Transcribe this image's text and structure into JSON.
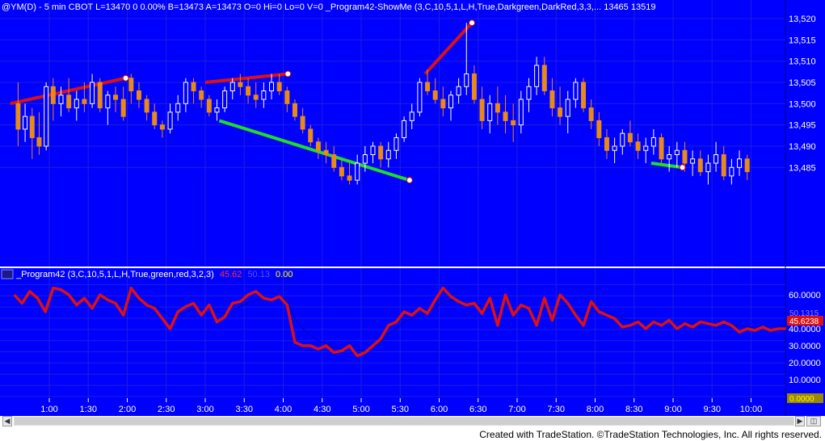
{
  "price_header": "@YM(D) - 5 min  CBOT  L=13470  0  0.00%  B=13473  A=13473  O=0  Hi=0  Lo=0  V=0  _Program42-ShowMe (3,C,10,5,1,L,H,True,Darkgreen,DarkRed,3,3,...  13465  13519",
  "indicator_header": {
    "name": "_Program42 (3,C,10,5,1,L,H,True,green,red,3,2,3)",
    "value1": "45.62",
    "value2": "50.13",
    "value3": "0.00",
    "value1_color": "#ff2020",
    "value2_color": "#4444ff",
    "value3_color": "#ffff00"
  },
  "price_axis_labels": [
    "13,520",
    "13,515",
    "13,510",
    "13,505",
    "13,500",
    "13,495",
    "13,490",
    "13,485"
  ],
  "indicator_axis_labels": [
    "60.0000",
    "40.0000",
    "30.0000",
    "20.0000",
    "10.0000"
  ],
  "indicator_value_tags": {
    "blue": "50.1315",
    "red": "45.6238",
    "yellow": "0.0000"
  },
  "time_axis_labels": [
    "1:00",
    "1:30",
    "2:00",
    "2:30",
    "3:00",
    "3:30",
    "4:00",
    "4:30",
    "5:00",
    "5:30",
    "6:00",
    "6:30",
    "7:00",
    "7:30",
    "8:00",
    "8:30",
    "9:00",
    "9:30",
    "10:00"
  ],
  "footer": "Created with TradeStation. ©TradeStation Technologies, Inc. All rights reserved.",
  "colors": {
    "background": "#0000ff",
    "grid": "#1e1ed8",
    "up_bar": "#ffffff",
    "down_bar": "#e88a18",
    "red_line": "#dd1111",
    "green_line": "#22dd22",
    "indicator_red": "#dd1111",
    "indicator_blue": "#0000aa"
  },
  "chart_data": {
    "type": "candlestick",
    "y_range": [
      13478,
      13522
    ],
    "x_range": [
      0.5,
      10.6
    ],
    "candles": [
      [
        0.6,
        13500,
        13505,
        13490,
        13494
      ],
      [
        0.69,
        13494,
        13500,
        13491,
        13497
      ],
      [
        0.78,
        13497,
        13499,
        13487,
        13492
      ],
      [
        0.87,
        13492,
        13498,
        13488,
        13490
      ],
      [
        0.96,
        13490,
        13505,
        13489,
        13504
      ],
      [
        1.05,
        13504,
        13506,
        13496,
        13500
      ],
      [
        1.15,
        13500,
        13504,
        13497,
        13502
      ],
      [
        1.25,
        13502,
        13506,
        13498,
        13499
      ],
      [
        1.35,
        13499,
        13503,
        13496,
        13501
      ],
      [
        1.45,
        13501,
        13505,
        13498,
        13500
      ],
      [
        1.55,
        13500,
        13507,
        13499,
        13505
      ],
      [
        1.65,
        13505,
        13506,
        13498,
        13499
      ],
      [
        1.75,
        13499,
        13503,
        13495,
        13502
      ],
      [
        1.85,
        13502,
        13504,
        13498,
        13501
      ],
      [
        1.95,
        13501,
        13504,
        13496,
        13497
      ],
      [
        2.05,
        13506,
        13507,
        13500,
        13503
      ],
      [
        2.15,
        13503,
        13505,
        13499,
        13501
      ],
      [
        2.25,
        13501,
        13502,
        13496,
        13498
      ],
      [
        2.35,
        13498,
        13500,
        13494,
        13495
      ],
      [
        2.45,
        13495,
        13496,
        13492,
        13494
      ],
      [
        2.55,
        13494,
        13500,
        13493,
        13498
      ],
      [
        2.65,
        13498,
        13502,
        13496,
        13500
      ],
      [
        2.75,
        13500,
        13506,
        13498,
        13505
      ],
      [
        2.85,
        13505,
        13506,
        13500,
        13503
      ],
      [
        2.95,
        13503,
        13504,
        13499,
        13501
      ],
      [
        3.05,
        13501,
        13502,
        13497,
        13498
      ],
      [
        3.15,
        13498,
        13501,
        13496,
        13499
      ],
      [
        3.25,
        13499,
        13504,
        13498,
        13503
      ],
      [
        3.35,
        13503,
        13506,
        13501,
        13505
      ],
      [
        3.45,
        13505,
        13507,
        13502,
        13504
      ],
      [
        3.55,
        13504,
        13506,
        13500,
        13502
      ],
      [
        3.65,
        13502,
        13505,
        13499,
        13501
      ],
      [
        3.75,
        13501,
        13505,
        13499,
        13503
      ],
      [
        3.85,
        13503,
        13507,
        13501,
        13505
      ],
      [
        3.95,
        13505,
        13507,
        13502,
        13503
      ],
      [
        4.05,
        13503,
        13504,
        13498,
        13500
      ],
      [
        4.15,
        13500,
        13501,
        13496,
        13497
      ],
      [
        4.25,
        13497,
        13499,
        13493,
        13494
      ],
      [
        4.35,
        13494,
        13495,
        13490,
        13491
      ],
      [
        4.45,
        13491,
        13492,
        13487,
        13489
      ],
      [
        4.55,
        13489,
        13491,
        13486,
        13488
      ],
      [
        4.65,
        13488,
        13490,
        13484,
        13485
      ],
      [
        4.75,
        13485,
        13487,
        13482,
        13483
      ],
      [
        4.85,
        13483,
        13486,
        13481,
        13482
      ],
      [
        4.95,
        13482,
        13488,
        13481,
        13486
      ],
      [
        5.05,
        13486,
        13490,
        13484,
        13488
      ],
      [
        5.15,
        13488,
        13491,
        13486,
        13490
      ],
      [
        5.25,
        13490,
        13491,
        13485,
        13487
      ],
      [
        5.35,
        13487,
        13491,
        13485,
        13489
      ],
      [
        5.45,
        13489,
        13493,
        13487,
        13492
      ],
      [
        5.55,
        13492,
        13497,
        13491,
        13496
      ],
      [
        5.65,
        13496,
        13500,
        13494,
        13498
      ],
      [
        5.75,
        13498,
        13506,
        13497,
        13505
      ],
      [
        5.85,
        13505,
        13508,
        13502,
        13503
      ],
      [
        5.95,
        13503,
        13506,
        13500,
        13501
      ],
      [
        6.05,
        13501,
        13504,
        13497,
        13499
      ],
      [
        6.15,
        13499,
        13503,
        13496,
        13502
      ],
      [
        6.25,
        13502,
        13506,
        13500,
        13504
      ],
      [
        6.35,
        13504,
        13519,
        13502,
        13507
      ],
      [
        6.45,
        13507,
        13509,
        13500,
        13501
      ],
      [
        6.55,
        13501,
        13504,
        13494,
        13496
      ],
      [
        6.65,
        13496,
        13502,
        13493,
        13500
      ],
      [
        6.75,
        13500,
        13504,
        13495,
        13498
      ],
      [
        6.85,
        13498,
        13502,
        13493,
        13496
      ],
      [
        6.95,
        13496,
        13500,
        13491,
        13495
      ],
      [
        7.05,
        13495,
        13503,
        13493,
        13501
      ],
      [
        7.15,
        13501,
        13506,
        13498,
        13504
      ],
      [
        7.25,
        13504,
        13511,
        13502,
        13509
      ],
      [
        7.35,
        13509,
        13511,
        13502,
        13503
      ],
      [
        7.45,
        13503,
        13506,
        13497,
        13499
      ],
      [
        7.55,
        13499,
        13504,
        13495,
        13497
      ],
      [
        7.65,
        13497,
        13503,
        13493,
        13501
      ],
      [
        7.75,
        13501,
        13506,
        13499,
        13505
      ],
      [
        7.85,
        13505,
        13506,
        13498,
        13499
      ],
      [
        7.95,
        13499,
        13501,
        13494,
        13496
      ],
      [
        8.05,
        13496,
        13498,
        13490,
        13492
      ],
      [
        8.15,
        13492,
        13494,
        13487,
        13489
      ],
      [
        8.25,
        13489,
        13492,
        13486,
        13490
      ],
      [
        8.35,
        13490,
        13494,
        13488,
        13493
      ],
      [
        8.45,
        13493,
        13496,
        13490,
        13491
      ],
      [
        8.55,
        13491,
        13493,
        13487,
        13489
      ],
      [
        8.65,
        13489,
        13492,
        13486,
        13490
      ],
      [
        8.75,
        13490,
        13494,
        13488,
        13492
      ],
      [
        8.85,
        13492,
        13493,
        13486,
        13487
      ],
      [
        8.95,
        13487,
        13490,
        13484,
        13488
      ],
      [
        9.05,
        13488,
        13491,
        13485,
        13489
      ],
      [
        9.15,
        13489,
        13491,
        13484,
        13486
      ],
      [
        9.25,
        13486,
        13489,
        13483,
        13487
      ],
      [
        9.35,
        13487,
        13489,
        13483,
        13484
      ],
      [
        9.45,
        13484,
        13488,
        13481,
        13486
      ],
      [
        9.55,
        13486,
        13491,
        13484,
        13488
      ],
      [
        9.65,
        13488,
        13490,
        13482,
        13483
      ],
      [
        9.75,
        13483,
        13487,
        13481,
        13485
      ],
      [
        9.85,
        13485,
        13489,
        13483,
        13487
      ],
      [
        9.95,
        13487,
        13488,
        13482,
        13484
      ]
    ],
    "overlay_lines": [
      {
        "color": "red",
        "points": [
          [
            0.5,
            13500
          ],
          [
            1.98,
            13506
          ]
        ]
      },
      {
        "color": "red",
        "points": [
          [
            3.0,
            13505
          ],
          [
            4.06,
            13507
          ]
        ]
      },
      {
        "color": "green",
        "points": [
          [
            3.18,
            13496
          ],
          [
            5.62,
            13482
          ]
        ]
      },
      {
        "color": "red",
        "points": [
          [
            5.82,
            13507
          ],
          [
            6.42,
            13519
          ]
        ]
      },
      {
        "color": "green",
        "points": [
          [
            8.72,
            13486
          ],
          [
            9.12,
            13485
          ]
        ]
      }
    ],
    "overlay_dots": [
      [
        1.98,
        13506
      ],
      [
        4.06,
        13507
      ],
      [
        5.62,
        13482
      ],
      [
        6.42,
        13519
      ],
      [
        9.12,
        13485
      ]
    ],
    "indicator": {
      "y_range": [
        0,
        68
      ],
      "x": [
        0.55,
        0.65,
        0.75,
        0.85,
        0.95,
        1.05,
        1.15,
        1.25,
        1.35,
        1.45,
        1.55,
        1.65,
        1.75,
        1.85,
        1.95,
        2.05,
        2.15,
        2.25,
        2.35,
        2.45,
        2.55,
        2.65,
        2.75,
        2.85,
        2.95,
        3.05,
        3.15,
        3.25,
        3.35,
        3.45,
        3.55,
        3.65,
        3.75,
        3.85,
        3.95,
        4.05,
        4.15,
        4.25,
        4.35,
        4.45,
        4.55,
        4.65,
        4.75,
        4.85,
        4.95,
        5.05,
        5.15,
        5.25,
        5.35,
        5.45,
        5.55,
        5.65,
        5.75,
        5.85,
        5.95,
        6.05,
        6.15,
        6.25,
        6.35,
        6.45,
        6.55,
        6.65,
        6.75,
        6.85,
        6.95,
        7.05,
        7.15,
        7.25,
        7.35,
        7.45,
        7.55,
        7.65,
        7.75,
        7.85,
        7.95,
        8.05,
        8.15,
        8.25,
        8.35,
        8.45,
        8.55,
        8.65,
        8.75,
        8.85,
        8.95,
        9.05,
        9.15,
        9.25,
        9.35,
        9.45,
        9.55,
        9.65,
        9.75,
        9.85,
        9.95,
        10.05,
        10.15,
        10.25,
        10.35,
        10.45
      ],
      "red": [
        60,
        55,
        62,
        58,
        50,
        64,
        63,
        60,
        54,
        58,
        52,
        60,
        57,
        55,
        48,
        64,
        58,
        54,
        52,
        46,
        40,
        50,
        53,
        55,
        48,
        54,
        44,
        47,
        55,
        56,
        60,
        62,
        58,
        57,
        59,
        54,
        32,
        30,
        30,
        28,
        30,
        26,
        27,
        30,
        24,
        26,
        30,
        34,
        42,
        44,
        50,
        48,
        52,
        49,
        57,
        64,
        59,
        56,
        54,
        55,
        49,
        58,
        42,
        60,
        48,
        54,
        52,
        42,
        58,
        45,
        60,
        55,
        48,
        42,
        56,
        50,
        48,
        46,
        41,
        42,
        44,
        40,
        44,
        42,
        45,
        40,
        43,
        41,
        44,
        43,
        42,
        44,
        42,
        38,
        40,
        39,
        41,
        39,
        40,
        40
      ],
      "blue": [
        58,
        57,
        58,
        57,
        56,
        58,
        59,
        59,
        58,
        58,
        57,
        57,
        56,
        56,
        54,
        56,
        56,
        55,
        54,
        51,
        47,
        48,
        50,
        52,
        51,
        52,
        50,
        49,
        51,
        53,
        55,
        57,
        57,
        57,
        58,
        57,
        46,
        40,
        36,
        33,
        31,
        29,
        28,
        29,
        27,
        27,
        29,
        32,
        37,
        40,
        44,
        46,
        48,
        49,
        52,
        56,
        57,
        56,
        55,
        55,
        53,
        54,
        50,
        53,
        51,
        52,
        52,
        49,
        52,
        50,
        53,
        53,
        51,
        48,
        50,
        50,
        49,
        48,
        46,
        45,
        45,
        44,
        44,
        44,
        44,
        43,
        43,
        43,
        43,
        43,
        43,
        43,
        43,
        42,
        41,
        41,
        41,
        41,
        41,
        41
      ]
    }
  }
}
